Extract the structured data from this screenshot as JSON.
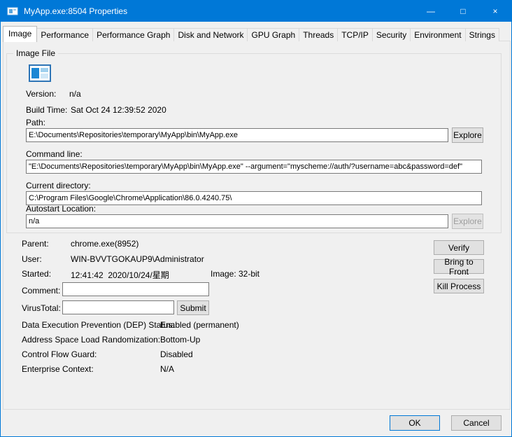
{
  "colors": {
    "accent": "#0078d7",
    "dialog_bg": "#f0f0f0",
    "titlebar_bg": "#0078d7"
  },
  "window": {
    "title": "MyApp.exe:8504 Properties",
    "controls": {
      "minimize": "—",
      "maximize": "□",
      "close": "×"
    }
  },
  "tabs": [
    {
      "label": "Image",
      "selected": true
    },
    {
      "label": "Performance"
    },
    {
      "label": "Performance Graph"
    },
    {
      "label": "Disk and Network"
    },
    {
      "label": "GPU Graph"
    },
    {
      "label": "Threads"
    },
    {
      "label": "TCP/IP"
    },
    {
      "label": "Security"
    },
    {
      "label": "Environment"
    },
    {
      "label": "Strings"
    }
  ],
  "image_file": {
    "group_label": "Image File",
    "app_icon": "myapp-window-icon",
    "version_label": "Version:",
    "version_value": "n/a",
    "build_time_label": "Build Time:",
    "build_time_value": "Sat Oct 24 12:39:52 2020",
    "path_label": "Path:",
    "path_value": "E:\\Documents\\Repositories\\temporary\\MyApp\\bin\\MyApp.exe",
    "explore_label": "Explore",
    "command_line_label": "Command line:",
    "command_line_value": "\"E:\\Documents\\Repositories\\temporary\\MyApp\\bin\\MyApp.exe\" --argument=\"myscheme://auth/?username=abc&password=def\"",
    "current_directory_label": "Current directory:",
    "current_directory_value": "C:\\Program Files\\Google\\Chrome\\Application\\86.0.4240.75\\",
    "autostart_label": "Autostart Location:",
    "autostart_value": "n/a",
    "explore2_label": "Explore"
  },
  "details": {
    "parent_label": "Parent:",
    "parent_value": "chrome.exe(8952)",
    "user_label": "User:",
    "user_value": "WIN-BVVTGOKAUP9\\Administrator",
    "started_label": "Started:",
    "started_value": "12:41:42  2020/10/24/星期",
    "image_label": "Image:",
    "image_value": "32-bit",
    "comment_label": "Comment:",
    "comment_value": "",
    "virustotal_label": "VirusTotal:",
    "virustotal_value": "",
    "submit_label": "Submit",
    "dep_label": "Data Execution Prevention (DEP) Status:",
    "dep_value": "Enabled (permanent)",
    "aslr_label": "Address Space Load Randomization:",
    "aslr_value": "Bottom-Up",
    "cfg_label": "Control Flow Guard:",
    "cfg_value": "Disabled",
    "enterprise_label": "Enterprise Context:",
    "enterprise_value": "N/A"
  },
  "side_buttons": {
    "verify": "Verify",
    "bring_to_front": "Bring to Front",
    "kill_process": "Kill Process"
  },
  "footer": {
    "ok": "OK",
    "cancel": "Cancel"
  }
}
